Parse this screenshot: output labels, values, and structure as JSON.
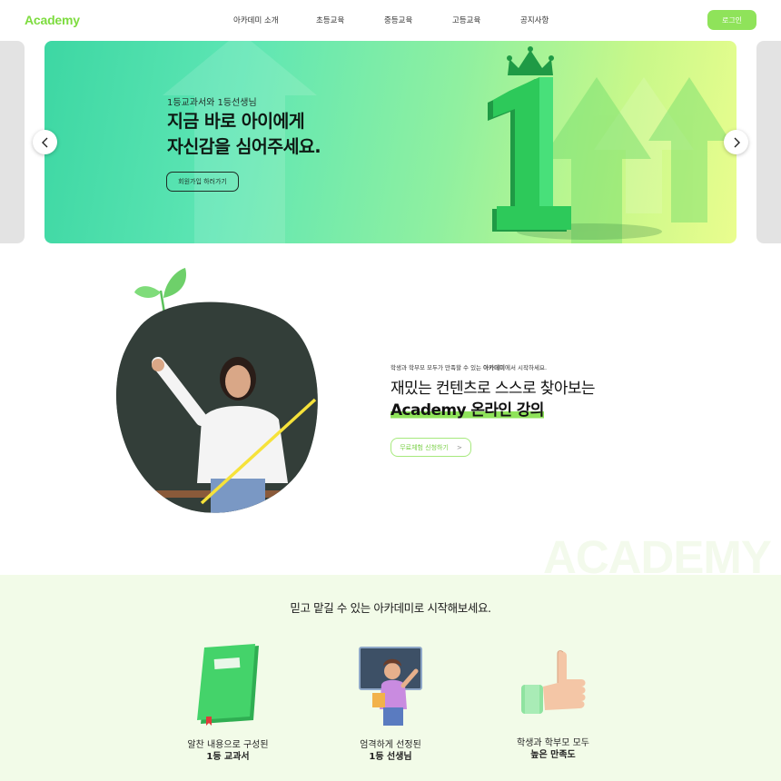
{
  "header": {
    "logo": "Academy",
    "nav": [
      "아카데미 소개",
      "초등교육",
      "중등교육",
      "고등교육",
      "공지사항"
    ],
    "login_label": "로그인"
  },
  "hero": {
    "eyebrow": "1등교과서와 1등선생님",
    "title_line1": "지금 바로 아이에게",
    "title_line2": "자신감을 심어주세요.",
    "button_label": "회원가입 하러가기"
  },
  "intro": {
    "eyebrow_prefix": "학생과 학부모 모두가 만족할 수 있는 ",
    "eyebrow_brand": "아카데미",
    "eyebrow_suffix": "에서 시작하세요.",
    "title_line1": "재밌는 컨텐츠로 스스로 찾아보는",
    "title_line2": "Academy 온라인 강의",
    "button_label": "무료체험 신청하기",
    "button_arrow": ">"
  },
  "watermark": "ACADEMY",
  "features": {
    "title": "믿고 맡길 수 있는 아카데미로 시작해보세요.",
    "items": [
      {
        "line1": "알찬 내용으로 구성된",
        "line2": "1등 교과서",
        "icon": "book-icon"
      },
      {
        "line1": "엄격하게 선정된",
        "line2": "1등 선생님",
        "icon": "teacher-icon"
      },
      {
        "line1": "학생과 학부모 모두",
        "line2": "높은 만족도",
        "icon": "thumbs-up-icon"
      }
    ]
  },
  "colors": {
    "accent": "#8fe35a",
    "logo": "#7ddc3f",
    "feature_bg": "#f2fbe8"
  }
}
